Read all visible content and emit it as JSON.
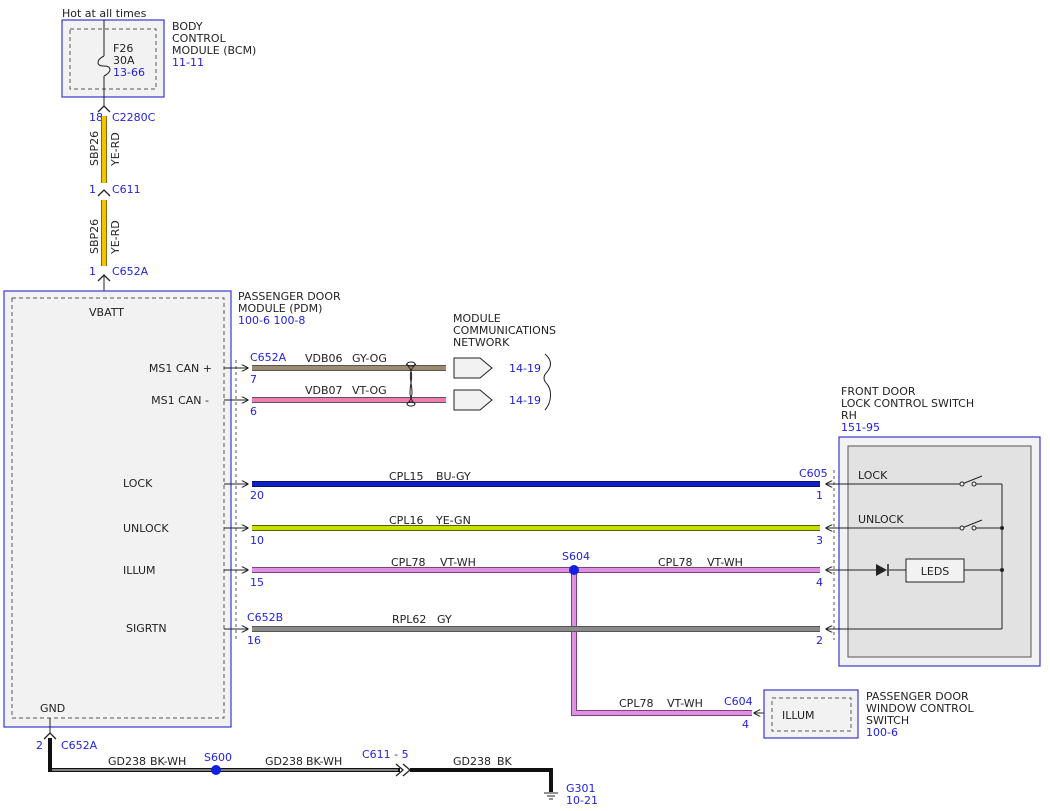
{
  "top": {
    "hot_label": "Hot at all times",
    "bcm_title": [
      "BODY",
      "CONTROL",
      "MODULE (BCM)"
    ],
    "bcm_ref": "11-11",
    "fuse": {
      "name": "F26",
      "rating": "30A",
      "ref": "13-66"
    },
    "pin_18": "18",
    "conn_c2280c": "C2280C",
    "circuit_1": "SBP26",
    "color_1": "YE-RD",
    "pin_1a": "1",
    "conn_c611": "C611",
    "circuit_2": "SBP26",
    "color_2": "YE-RD",
    "pin_1b": "1",
    "conn_c652a_top": "C652A"
  },
  "pdm": {
    "title": [
      "PASSENGER DOOR",
      "MODULE (PDM)"
    ],
    "refs": "100-6 100-8",
    "vbatt": "VBATT",
    "gnd": "GND",
    "pins": [
      "MS1 CAN +",
      "MS1 CAN -",
      "LOCK",
      "UNLOCK",
      "ILLUM",
      "SIGRTN"
    ]
  },
  "network": {
    "title": [
      "MODULE",
      "COMMUNICATIONS",
      "NETWORK"
    ],
    "conn": "C652A",
    "can_plus": {
      "pin": "7",
      "circuit": "VDB06",
      "color": "GY-OG",
      "ref": "14-19"
    },
    "can_minus": {
      "pin": "6",
      "circuit": "VDB07",
      "color": "VT-OG",
      "ref": "14-19"
    }
  },
  "wires": {
    "lock": {
      "pin_left": "20",
      "circuit": "CPL15",
      "color": "BU-GY",
      "conn_right": "C605",
      "pin_right": "1"
    },
    "unlock": {
      "pin_left": "10",
      "circuit": "CPL16",
      "color": "YE-GN",
      "pin_right": "3"
    },
    "illum": {
      "pin_left": "15",
      "circuit_left": "CPL78",
      "color_left": "VT-WH",
      "splice": "S604",
      "circuit_right": "CPL78",
      "color_right": "VT-WH",
      "pin_right": "4"
    },
    "sigrtn": {
      "conn_left": "C652B",
      "pin_left": "16",
      "circuit": "RPL62",
      "color": "GY",
      "pin_right": "2"
    }
  },
  "switch": {
    "title": [
      "FRONT DOOR",
      "LOCK CONTROL SWITCH",
      "RH"
    ],
    "ref": "151-95",
    "lock": "LOCK",
    "unlock": "UNLOCK",
    "leds": "LEDS"
  },
  "window_switch": {
    "circuit": "CPL78",
    "color": "VT-WH",
    "conn": "C604",
    "pin": "4",
    "label": "ILLUM",
    "title": [
      "PASSENGER DOOR",
      "WINDOW CONTROL",
      "SWITCH"
    ],
    "ref": "100-6"
  },
  "ground": {
    "pin": "2",
    "conn": "C652A",
    "circuit_1": "GD238",
    "color_1": "BK-WH",
    "splice": "S600",
    "circuit_2": "GD238",
    "color_2": "BK-WH",
    "conn_2": "C611 - 5",
    "circuit_3": "GD238",
    "color_3": "BK",
    "ground_id": "G301",
    "ground_ref": "10-21"
  },
  "colors": {
    "ref_blue": "#2222dd",
    "ye_rd": "#f2c400",
    "gy_og": "#9e8a6e",
    "vt_og": "#f07bb0",
    "bu_gy": "#1020c8",
    "ye_gn": "#c8e000",
    "vt_wh": "#e090e0",
    "gy": "#8a8a8a",
    "bk": "#111111"
  }
}
